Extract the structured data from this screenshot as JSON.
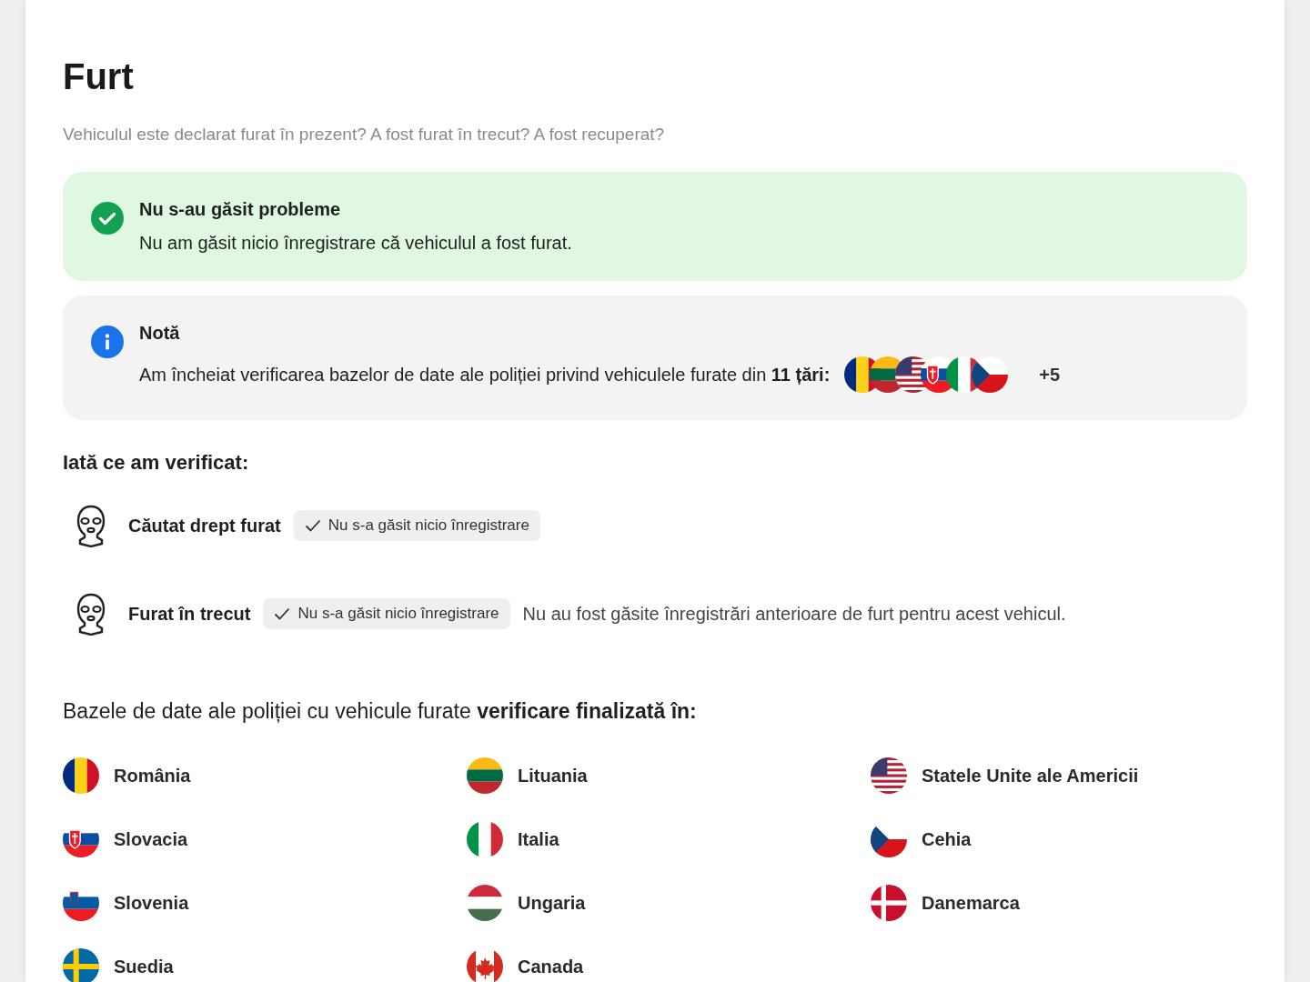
{
  "section": {
    "title": "Furt",
    "subtitle": "Vehiculul este declarat furat în prezent? A fost furat în trecut? A fost recuperat?"
  },
  "alerts": [
    {
      "kind": "success",
      "title": "Nu s-au găsit probleme",
      "text": "Nu am găsit nicio înregistrare că vehiculul a fost furat."
    },
    {
      "kind": "info",
      "title": "Notă",
      "text": "Am încheiat verificarea bazelor de date ale poliției privind vehiculele furate din **11 țări:**",
      "flags": [
        {
          "kind": "ro"
        },
        {
          "kind": "lt"
        },
        {
          "kind": "us"
        },
        {
          "kind": "sk"
        },
        {
          "kind": "it"
        },
        {
          "kind": "cz"
        }
      ],
      "more": "+5"
    }
  ],
  "checks_heading": "Iată ce am verificat:",
  "checks": [
    {
      "label": "Căutat drept furat",
      "badge": "Nu s-a găsit nicio înregistrare"
    },
    {
      "label": "Furat în trecut",
      "badge": "Nu s-a găsit nicio înregistrare",
      "description": "Nu au fost găsite înregistrări anterioare de furt pentru acest vehicul."
    }
  ],
  "countries_heading": "Bazele de date ale poliției cu vehicule furate **verificare finalizată în:**",
  "countries": [
    {
      "kind": "ro",
      "name": "România"
    },
    {
      "kind": "lt",
      "name": "Lituania"
    },
    {
      "kind": "us",
      "name": "Statele Unite ale Americii"
    },
    {
      "kind": "sk",
      "name": "Slovacia"
    },
    {
      "kind": "it",
      "name": "Italia"
    },
    {
      "kind": "cz",
      "name": "Cehia"
    },
    {
      "kind": "si",
      "name": "Slovenia"
    },
    {
      "kind": "hu",
      "name": "Ungaria"
    },
    {
      "kind": "dk",
      "name": "Danemarca"
    },
    {
      "kind": "se",
      "name": "Suedia"
    },
    {
      "kind": "ca",
      "name": "Canada"
    }
  ]
}
